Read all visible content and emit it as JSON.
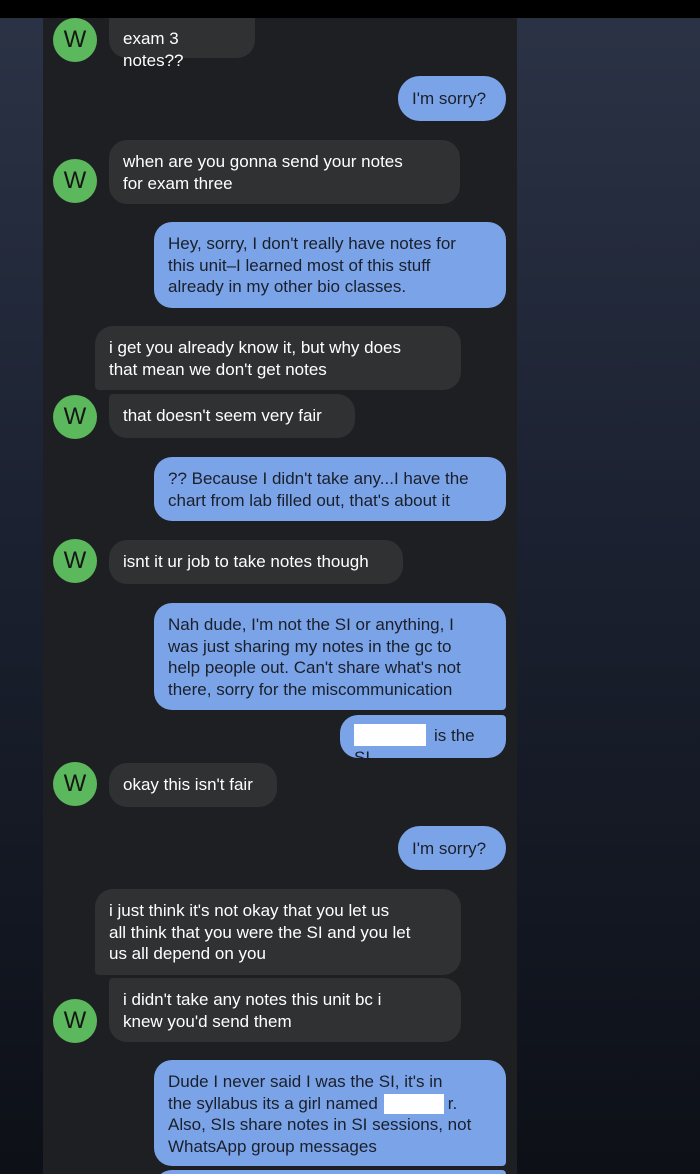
{
  "contact": {
    "avatar_letter": "W"
  },
  "messages": [
    {
      "from": "them",
      "text": "exam 3 notes??"
    },
    {
      "from": "me",
      "text": "I'm sorry?"
    },
    {
      "from": "them",
      "text": "when are you gonna send your notes\nfor exam three"
    },
    {
      "from": "me",
      "text": "Hey, sorry, I don't really have notes for\nthis unit–I learned most of this stuff\nalready in my other bio classes."
    },
    {
      "from": "them",
      "text": "i get you already know it, but why does\nthat mean we don't get notes"
    },
    {
      "from": "them",
      "text": "that doesn't seem very fair"
    },
    {
      "from": "me",
      "text": "?? Because I didn't take any...I have the\nchart from lab filled out, that's about it"
    },
    {
      "from": "them",
      "text": "isnt it ur job to take notes though"
    },
    {
      "from": "me",
      "text": "Nah dude, I'm not the SI or anything, I\nwas just sharing my notes in the gc to\nhelp people out. Can't share what's not\nthere, sorry for the miscommunication"
    },
    {
      "from": "me",
      "text": "is the SI"
    },
    {
      "from": "them",
      "text": "okay this isn't fair"
    },
    {
      "from": "me",
      "text": "I'm sorry?"
    },
    {
      "from": "them",
      "text": "i just think it's not okay that you let us\nall think that you were the SI and you let\nus all depend on you"
    },
    {
      "from": "them",
      "text": "i didn't take any notes this unit bc i\nknew you'd send them"
    },
    {
      "from": "me",
      "text_a": "Dude I never said I was the SI, it's in\nthe syllabus its a girl named",
      "text_b": "r.",
      "text_c": "Also, SIs share notes in SI sessions, not\nWhatsApp group messages"
    }
  ]
}
